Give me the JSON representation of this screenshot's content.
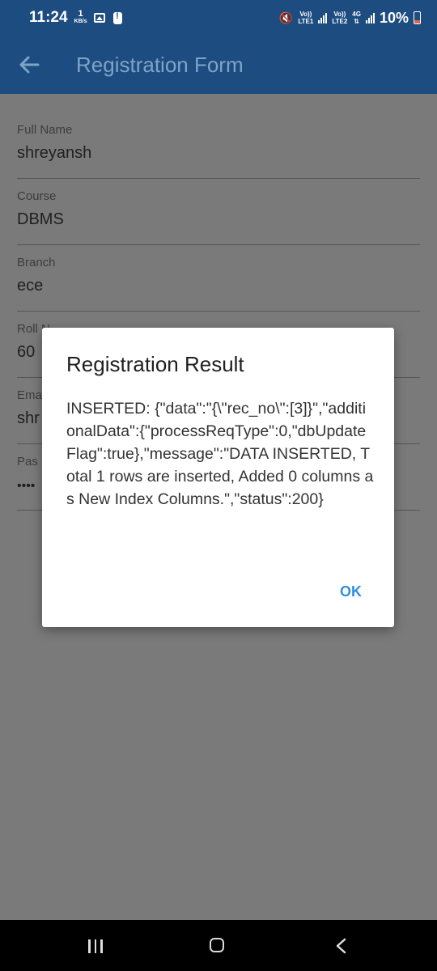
{
  "status_bar": {
    "time": "11:24",
    "net_speed": "1",
    "net_unit": "KB/s",
    "sim1": [
      "Vo))",
      "LTE1"
    ],
    "sim2": [
      "Vo))",
      "LTE2"
    ],
    "net_type": "4G",
    "battery": "10%"
  },
  "app_bar": {
    "title": "Registration Form"
  },
  "form": {
    "fields": [
      {
        "label": "Full Name",
        "value": "shreyansh"
      },
      {
        "label": "Course",
        "value": "DBMS"
      },
      {
        "label": "Branch",
        "value": "ece"
      },
      {
        "label": "Roll N",
        "value": "60"
      },
      {
        "label": "Ema",
        "value": "shr"
      },
      {
        "label": "Pas",
        "value": "••••"
      }
    ]
  },
  "dialog": {
    "title": "Registration Result",
    "message": "INSERTED: {\"data\":\"{\\\"rec_no\\\":[3]}\",\"additionalData\":{\"processReqType\":0,\"dbUpdateFlag\":true},\"message\":\"DATA INSERTED, Total 1 rows are inserted, Added 0 columns as New Index Columns.\",\"status\":200}",
    "ok_label": "OK"
  },
  "colors": {
    "primary": "#1c4c80",
    "accent": "#2f8fe0",
    "scrim_background": "#7a7a7a"
  },
  "icons": [
    "back-arrow-icon",
    "recents-icon",
    "home-icon",
    "nav-back-icon"
  ]
}
